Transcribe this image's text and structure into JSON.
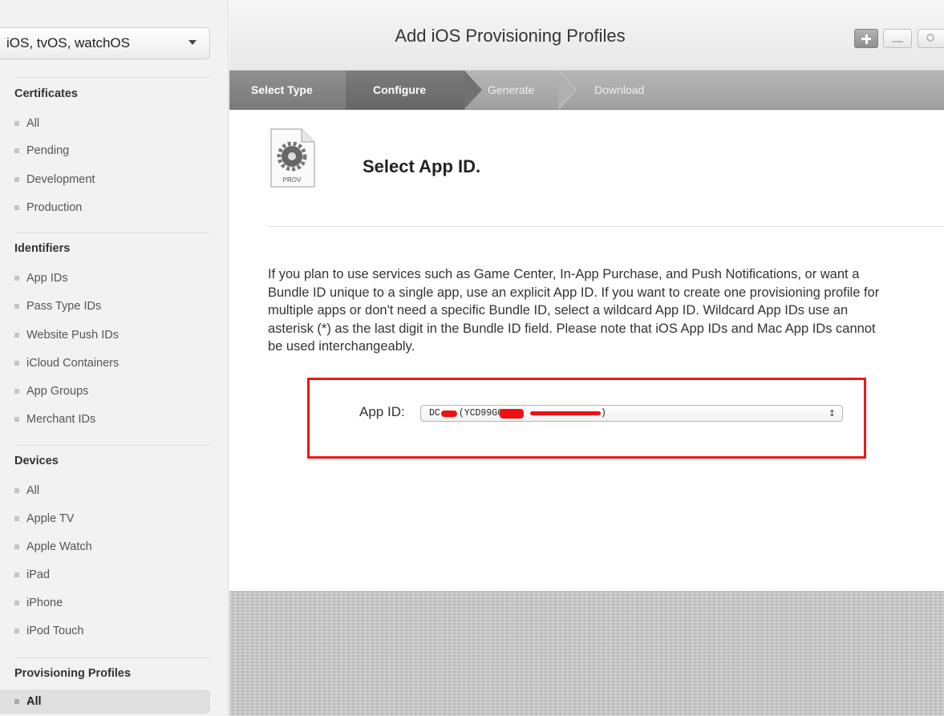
{
  "sidebar": {
    "platform": "iOS, tvOS, watchOS",
    "certificates": {
      "heading": "Certificates",
      "items": [
        "All",
        "Pending",
        "Development",
        "Production"
      ]
    },
    "identifiers": {
      "heading": "Identifiers",
      "items": [
        "App IDs",
        "Pass Type IDs",
        "Website Push IDs",
        "iCloud Containers",
        "App Groups",
        "Merchant IDs"
      ]
    },
    "devices": {
      "heading": "Devices",
      "items": [
        "All",
        "Apple TV",
        "Apple Watch",
        "iPad",
        "iPhone",
        "iPod Touch"
      ]
    },
    "profiles": {
      "heading": "Provisioning Profiles",
      "items": [
        "All"
      ]
    }
  },
  "header": {
    "title": "Add iOS Provisioning Profiles",
    "add_icon": "plus-icon",
    "edit_icon": "edit-icon",
    "search_icon": "search-icon"
  },
  "steps": [
    "Select Type",
    "Configure",
    "Generate",
    "Download"
  ],
  "content": {
    "icon_label": "PROV",
    "title": "Select App ID.",
    "description": "If you plan to use services such as Game Center, In-App Purchase, and Push Notifications, or want a Bundle ID unique to a single app, use an explicit App ID. If you want to create one provisioning profile for multiple apps or don't need a specific Bundle ID, select a wildcard App ID. Wildcard App IDs use an asterisk (*) as the last digit in the Bundle ID field. Please note that iOS App IDs and Mac App IDs cannot be used interchangeably.",
    "app_id_label": "App ID:",
    "app_id_value_prefix": "DC",
    "app_id_value_team": "(YCD99G6",
    "app_id_value_suffix": ")"
  },
  "colors": {
    "highlight": "#f01616",
    "redaction": "#ee1010",
    "steps_bar": "#a8a8a8"
  }
}
